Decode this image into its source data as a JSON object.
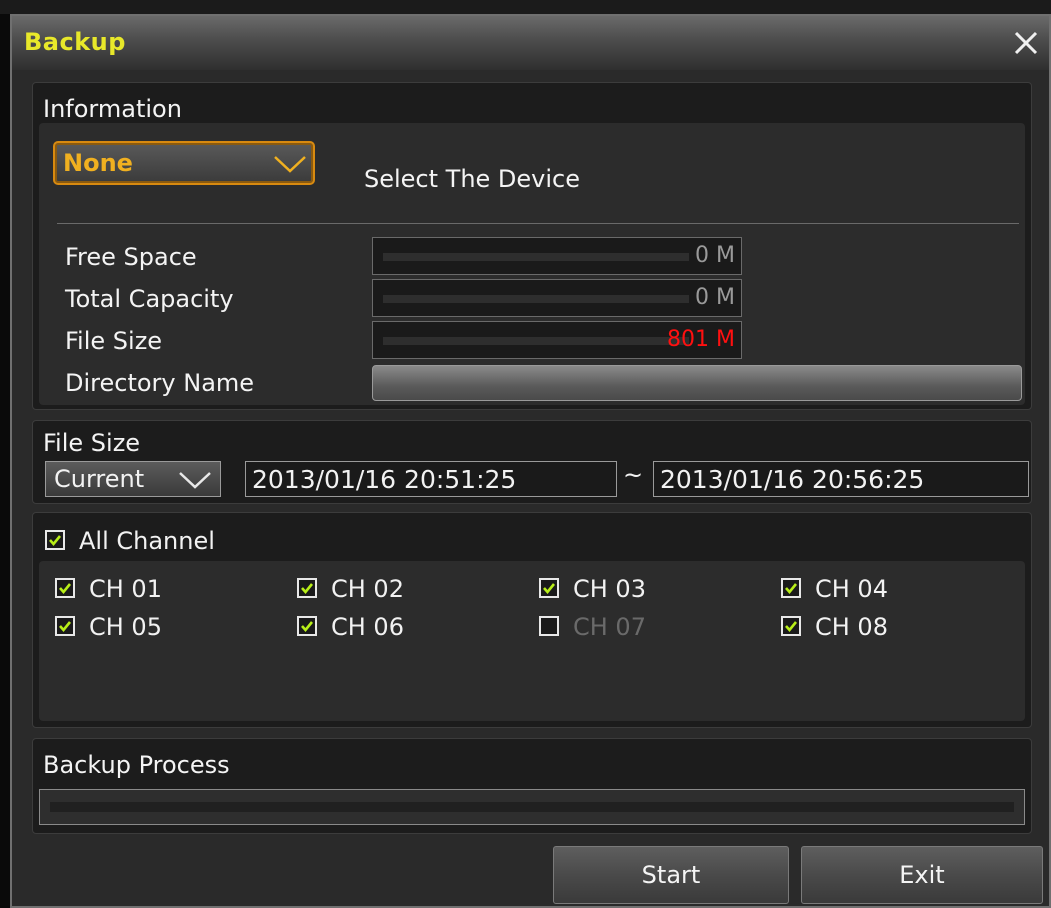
{
  "window": {
    "title": "Backup"
  },
  "info": {
    "heading": "Information",
    "device_select": {
      "value": "None"
    },
    "device_hint": "Select The Device",
    "free_space": {
      "label": "Free Space",
      "value": "0 M"
    },
    "total_capacity": {
      "label": "Total Capacity",
      "value": "0 M"
    },
    "file_size": {
      "label": "File Size",
      "value": "801 M"
    },
    "directory_name": {
      "label": "Directory Name",
      "value": ""
    }
  },
  "range": {
    "heading": "File Size",
    "select_value": "Current",
    "start": "2013/01/16  20:51:25",
    "separator": "~",
    "end": "2013/01/16  20:56:25"
  },
  "channels": {
    "all_label": "All Channel",
    "all_checked": true,
    "items": [
      {
        "label": "CH 01",
        "checked": true
      },
      {
        "label": "CH 02",
        "checked": true
      },
      {
        "label": "CH 03",
        "checked": true
      },
      {
        "label": "CH 04",
        "checked": true
      },
      {
        "label": "CH 05",
        "checked": true
      },
      {
        "label": "CH 06",
        "checked": true
      },
      {
        "label": "CH 07",
        "checked": false
      },
      {
        "label": "CH 08",
        "checked": true
      }
    ]
  },
  "process": {
    "heading": "Backup Process",
    "progress": 0
  },
  "buttons": {
    "start": "Start",
    "exit": "Exit"
  },
  "colors": {
    "title": "#e8e82a",
    "device_value": "#f0b020",
    "file_size_value": "#ff1010",
    "checkmark": "#b8ee18",
    "disabled_text": "#6a6a6a"
  },
  "icons": {
    "close": "close-icon",
    "dropdown": "chevron-down-icon",
    "checkbox": "checkmark-icon"
  }
}
